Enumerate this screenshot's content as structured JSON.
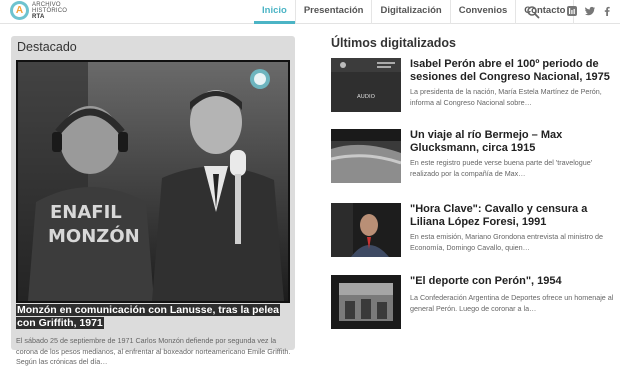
{
  "logo": {
    "mark": "A",
    "line1": "ARCHIVO",
    "line2": "HISTÓRICO",
    "line3": "RTA"
  },
  "nav": [
    "Inicio",
    "Presentación",
    "Digitalización",
    "Convenios",
    "Contacto"
  ],
  "colors": {
    "accent": "#4bb4c5",
    "logo_orange": "#f2a23a",
    "panel": "#dcdcdc"
  },
  "featured": {
    "heading": "Destacado",
    "title": "Monzón en comunicación con Lanusse, tras la pelea con Griffith, 1971",
    "description": "El sábado 25 de septiembre de 1971 Carlos Monzón defiende por segunda vez la corona de los pesos medianos, al enfrentar al boxeador norteamericano Emile Griffith. Según las crónicas del día…",
    "sweater_text": "ENAFIL MONZÓN"
  },
  "latest": {
    "heading": "Últimos digitalizados",
    "items": [
      {
        "title": "Isabel Perón abre el 100º periodo de sesiones del Congreso Nacional, 1975",
        "description": "La presidenta de la nación, María Estela Martínez de Perón, informa al Congreso Nacional sobre…",
        "thumb_label": "AUDIO"
      },
      {
        "title": "Un viaje al río Bermejo – Max Glucksmann, circa 1915",
        "description": "En este registro puede verse buena parte del 'travelogue' realizado por la compañía de Max…"
      },
      {
        "title": "\"Hora Clave\": Cavallo y censura a Liliana López Foresi, 1991",
        "description": "En esta emisión, Mariano Grondona entrevista al ministro de Economía, Domingo Cavallo, quien…"
      },
      {
        "title": "\"El deporte con Perón\", 1954",
        "description": "La Confederación Argentina de Deportes ofrece un homenaje al general Perón. Luego de coronar a la…"
      }
    ]
  },
  "icons": [
    "search-icon",
    "youtube-icon",
    "twitter-icon",
    "facebook-icon"
  ]
}
